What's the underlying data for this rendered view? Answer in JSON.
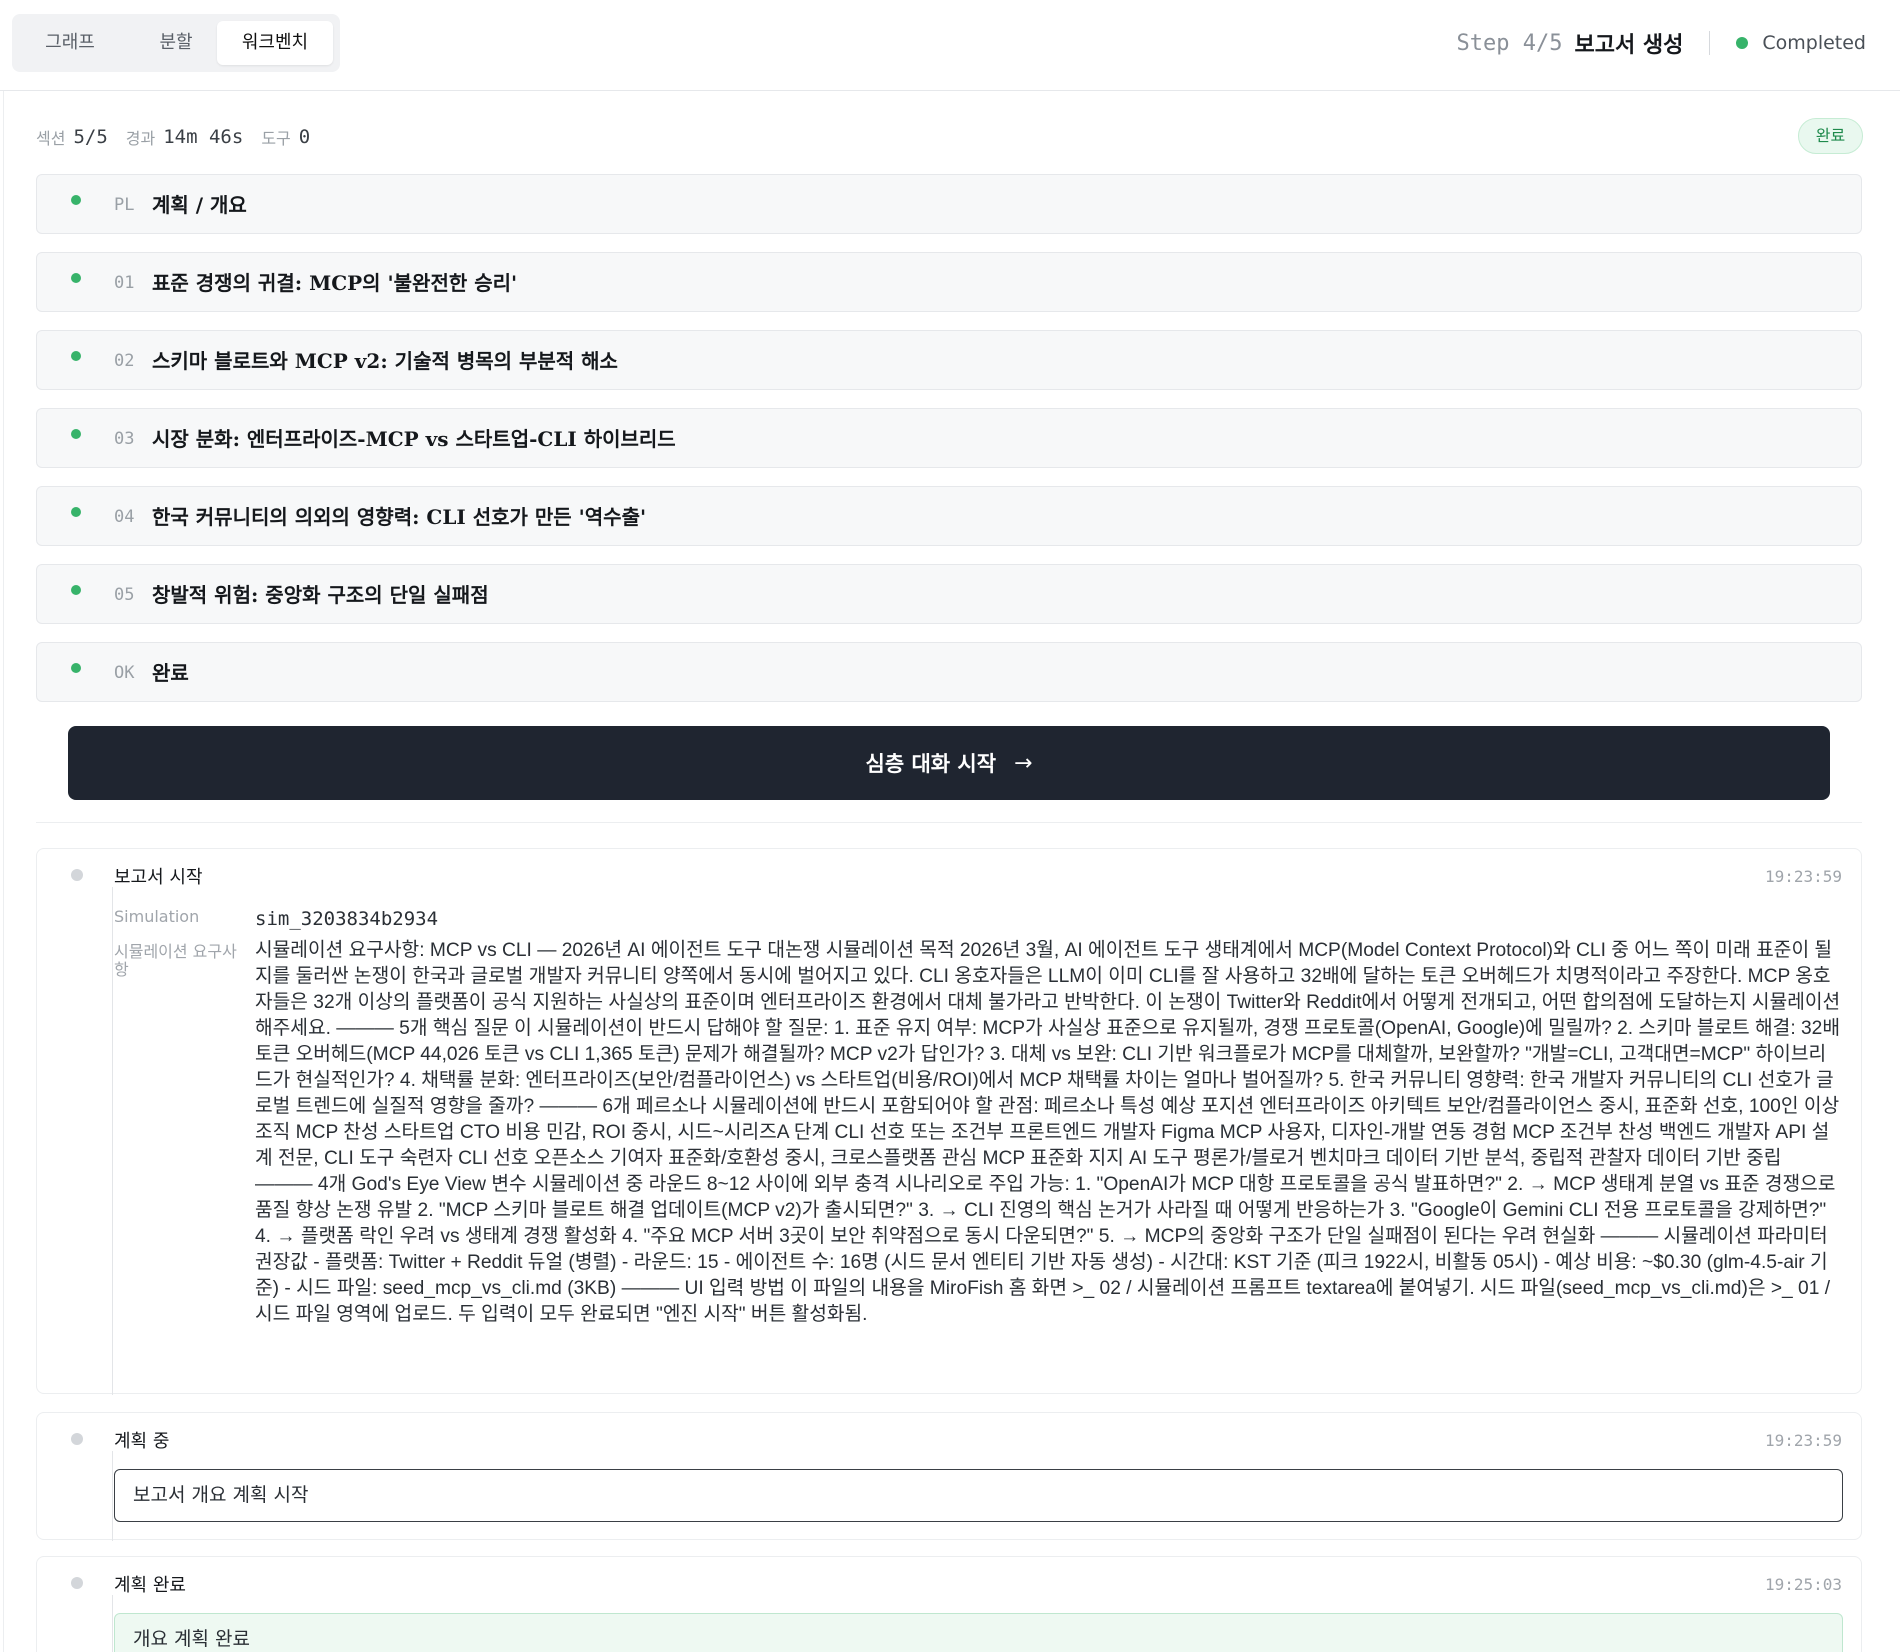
{
  "tabs": [
    {
      "label": "그래프"
    },
    {
      "label": "분할"
    },
    {
      "label": "워크벤치"
    }
  ],
  "header": {
    "step_label": "Step 4/5",
    "step_title": "보고서 생성",
    "status": "Completed",
    "status_color": "#37b36a"
  },
  "meta": {
    "section_key": "섹션",
    "section_val": "5/5",
    "elapsed_key": "경과",
    "elapsed_val": "14m 46s",
    "tools_key": "도구",
    "tools_val": "0",
    "badge": "완료"
  },
  "sections": [
    {
      "code": "PL",
      "title": "계획 / 개요"
    },
    {
      "code": "01",
      "title": "표준 경쟁의 귀결: MCP의 '불완전한 승리'"
    },
    {
      "code": "02",
      "title": "스키마 블로트와 MCP v2: 기술적 병목의 부분적 해소"
    },
    {
      "code": "03",
      "title": "시장 분화: 엔터프라이즈-MCP vs 스타트업-CLI 하이브리드"
    },
    {
      "code": "04",
      "title": "한국 커뮤니티의 의외의 영향력: CLI 선호가 만든 '역수출'"
    },
    {
      "code": "05",
      "title": "창발적 위험: 중앙화 구조의 단일 실패점"
    },
    {
      "code": "OK",
      "title": "완료"
    }
  ],
  "cta": {
    "label": "심층 대화 시작",
    "arrow": "→",
    "color": "#1f2530"
  },
  "logs": {
    "start": {
      "title": "보고서 시작",
      "time": "19:23:59",
      "sim_key": "Simulation",
      "sim_val": "sim_3203834b2934",
      "req_key": "시뮬레이션 요구사항",
      "req_val": "시뮬레이션 요구사항: MCP vs CLI — 2026년 AI 에이전트 도구 대논쟁 시뮬레이션 목적 2026년 3월, AI 에이전트 도구 생태계에서 MCP(Model Context Protocol)와 CLI 중 어느 쪽이 미래 표준이 될지를 둘러싼 논쟁이 한국과 글로벌 개발자 커뮤니티 양쪽에서 동시에 벌어지고 있다. CLI 옹호자들은 LLM이 이미 CLI를 잘 사용하고 32배에 달하는 토큰 오버헤드가 치명적이라고 주장한다. MCP 옹호자들은 32개 이상의 플랫폼이 공식 지원하는 사실상의 표준이며 엔터프라이즈 환경에서 대체 불가라고 반박한다. 이 논쟁이 Twitter와 Reddit에서 어떻게 전개되고, 어떤 합의점에 도달하는지 시뮬레이션해주세요. ——— 5개 핵심 질문 이 시뮬레이션이 반드시 답해야 할 질문: 1. 표준 유지 여부: MCP가 사실상 표준으로 유지될까, 경쟁 프로토콜(OpenAI, Google)에 밀릴까? 2. 스키마 블로트 해결: 32배 토큰 오버헤드(MCP 44,026 토큰 vs CLI 1,365 토큰) 문제가 해결될까? MCP v2가 답인가? 3. 대체 vs 보완: CLI 기반 워크플로가 MCP를 대체할까, 보완할까? \"개발=CLI, 고객대면=MCP\" 하이브리드가 현실적인가? 4. 채택률 분화: 엔터프라이즈(보안/컴플라이언스) vs 스타트업(비용/ROI)에서 MCP 채택률 차이는 얼마나 벌어질까? 5. 한국 커뮤니티 영향력: 한국 개발자 커뮤니티의 CLI 선호가 글로벌 트렌드에 실질적 영향을 줄까? ——— 6개 페르소나 시뮬레이션에 반드시 포함되어야 할 관점: 페르소나 특성 예상 포지션 엔터프라이즈 아키텍트 보안/컴플라이언스 중시, 표준화 선호, 100인 이상 조직 MCP 찬성 스타트업 CTO 비용 민감, ROI 중시, 시드~시리즈A 단계 CLI 선호 또는 조건부 프론트엔드 개발자 Figma MCP 사용자, 디자인-개발 연동 경험 MCP 조건부 찬성 백엔드 개발자 API 설계 전문, CLI 도구 숙련자 CLI 선호 오픈소스 기여자 표준화/호환성 중시, 크로스플랫폼 관심 MCP 표준화 지지 AI 도구 평론가/블로거 벤치마크 데이터 기반 분석, 중립적 관찰자 데이터 기반 중립 ——— 4개 God's Eye View 변수 시뮬레이션 중 라운드 8~12 사이에 외부 충격 시나리오로 주입 가능: 1. \"OpenAI가 MCP 대항 프로토콜을 공식 발표하면?\" 2. → MCP 생태계 분열 vs 표준 경쟁으로 품질 향상 논쟁 유발 2. \"MCP 스키마 블로트 해결 업데이트(MCP v2)가 출시되면?\" 3. → CLI 진영의 핵심 논거가 사라질 때 어떻게 반응하는가 3. \"Google이 Gemini CLI 전용 프로토콜을 강제하면?\" 4. → 플랫폼 락인 우려 vs 생태계 경쟁 활성화 4. \"주요 MCP 서버 3곳이 보안 취약점으로 동시 다운되면?\" 5. → MCP의 중앙화 구조가 단일 실패점이 된다는 우려 현실화 ——— 시뮬레이션 파라미터 권장값 - 플랫폼: Twitter + Reddit 듀얼 (병렬) - 라운드: 15 - 에이전트 수: 16명 (시드 문서 엔티티 기반 자동 생성) - 시간대: KST 기준 (피크 1922시, 비활동 05시) - 예상 비용: ~$0.30 (glm-4.5-air 기준) - 시드 파일: seed_mcp_vs_cli.md (3KB) ——— UI 입력 방법 이 파일의 내용을 MiroFish 홈 화면 >_ 02 / 시뮬레이션 프롬프트 textarea에 붙여넣기. 시드 파일(seed_mcp_vs_cli.md)은 >_ 01 / 시드 파일 영역에 업로드. 두 입력이 모두 완료되면 \"엔진 시작\" 버튼 활성화됨."
    },
    "planning": {
      "title": "계획 중",
      "time": "19:23:59",
      "message": "보고서 개요 계획 시작"
    },
    "planned": {
      "title": "계획 완료",
      "time": "19:25:03",
      "message": "개요 계획 완료"
    }
  }
}
